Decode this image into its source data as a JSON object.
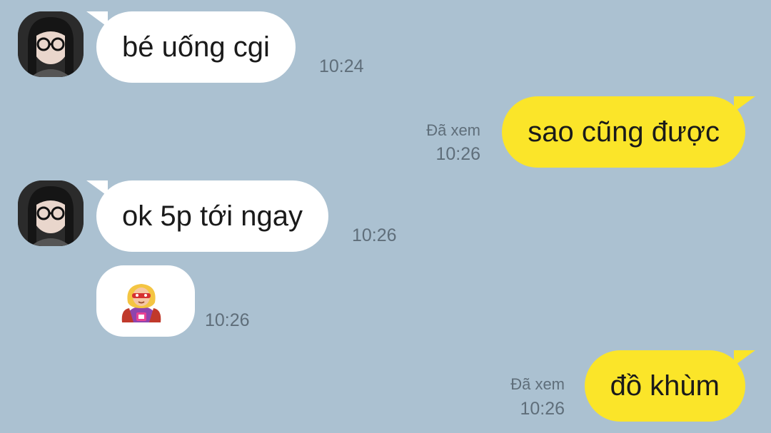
{
  "messages": [
    {
      "direction": "in",
      "text": "bé uống cgi",
      "time": "10:24"
    },
    {
      "direction": "out",
      "text": "sao cũng được",
      "status": "Đã xem",
      "time": "10:26"
    },
    {
      "direction": "in",
      "text": "ok 5p tới ngay",
      "time": "10:26"
    },
    {
      "direction": "in",
      "emoji": "superhero-woman",
      "time": "10:26"
    },
    {
      "direction": "out",
      "text": "đồ khùm",
      "status": "Đã xem",
      "time": "10:26"
    }
  ],
  "colors": {
    "background": "#abc1d1",
    "incoming_bubble": "#ffffff",
    "outgoing_bubble": "#fbe529",
    "meta_text": "#5f6e7a"
  }
}
